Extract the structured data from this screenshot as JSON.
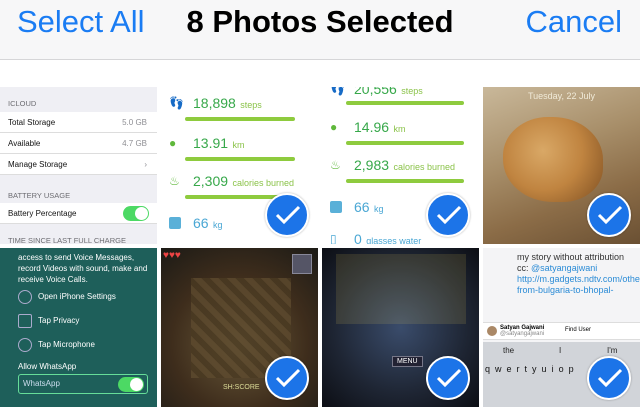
{
  "header": {
    "select_all": "Select All",
    "title": "8 Photos Selected",
    "cancel": "Cancel"
  },
  "cells": {
    "settings": {
      "icloud_header": "ICLOUD",
      "rows": [
        {
          "label": "Total Storage",
          "value": "5.0 GB"
        },
        {
          "label": "Available",
          "value": "4.7 GB"
        },
        {
          "label": "Manage Storage",
          "value": "›"
        }
      ],
      "battery_header": "BATTERY USAGE",
      "battery_row": "Battery Percentage",
      "since_header": "TIME SINCE LAST FULL CHARGE"
    },
    "fitness1": {
      "steps": "18,898",
      "steps_unit": "steps",
      "km": "13.91",
      "km_unit": "km",
      "cal": "2,309",
      "cal_unit": "calories burned",
      "kg": "66",
      "kg_unit": "kg"
    },
    "fitness2": {
      "steps": "20,556",
      "steps_unit": "steps",
      "km": "14.96",
      "km_unit": "km",
      "cal": "2,983",
      "cal_unit": "calories burned",
      "kg": "66",
      "kg_unit": "kg",
      "water": "0",
      "water_unit": "glasses water"
    },
    "dog": {
      "date": "Tuesday, 22 July"
    },
    "whatsapp": {
      "intro": "access to send Voice Messages, record Videos with sound, make and receive Voice Calls.",
      "steps": [
        "Open iPhone Settings",
        "Tap Privacy",
        "Tap Microphone"
      ],
      "allow": "Allow WhatsApp",
      "toggle_label": "WhatsApp"
    },
    "game1": {
      "tag": "SH:SCORE"
    },
    "game2": {
      "menu": "MENU"
    },
    "tweet": {
      "text": "my story without attribution cc:",
      "handle": "@satyangajwani",
      "link": "http://m.gadgets.ndtv.com/others/features/hitchhiking-from-bulgaria-to-bhopal-",
      "user": "Satyan Gajwani",
      "user_handle": "@satyangajwani",
      "find_user": "Find User",
      "suggestions": [
        "the",
        "I",
        "I'm"
      ],
      "keys": [
        "q",
        "w",
        "e",
        "r",
        "t",
        "y",
        "u",
        "i",
        "o",
        "p"
      ]
    }
  }
}
